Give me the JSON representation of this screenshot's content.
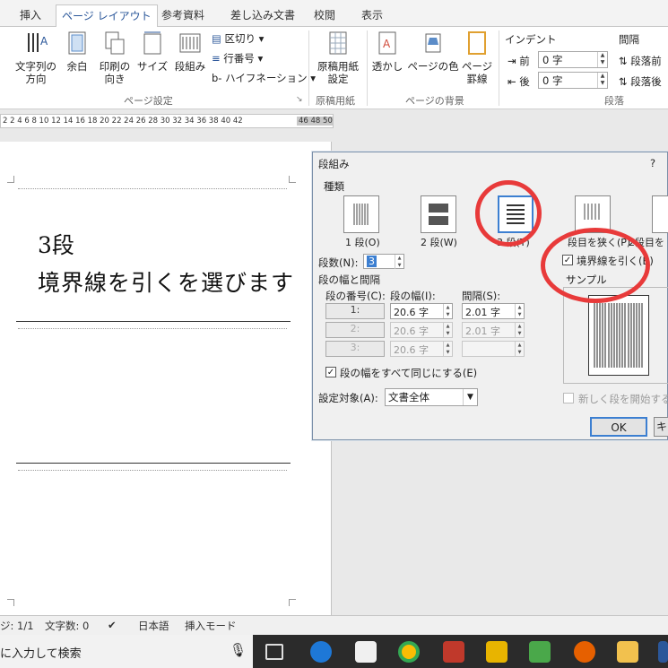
{
  "tabs": [
    "挿入",
    "ページ レイアウト",
    "参考資料",
    "差し込み文書",
    "校閲",
    "表示"
  ],
  "ribbon": {
    "text_direction": "文字列の\n方向",
    "margins": "余白",
    "orientation": "印刷の\n向き",
    "size": "サイズ",
    "columns": "段組み",
    "breaks": "区切り",
    "line_numbers": "行番号",
    "hyphenation": "ハイフネーション",
    "page_setup_group": "ページ設定",
    "manuscript": "原稿用紙\n設定",
    "manuscript_group": "原稿用紙",
    "watermark": "透かし",
    "page_color": "ページの色",
    "page_border": "ページ\n罫線",
    "page_bg_group": "ページの背景",
    "indent_label": "インデント",
    "indent_before_label": "前",
    "indent_before_value": "0 字",
    "indent_after_label": "後",
    "indent_after_value": "0 字",
    "spacing_label": "間隔",
    "spacing_before": "段落前",
    "spacing_after": "段落後",
    "paragraph_group": "段落"
  },
  "ruler": {
    "numbers": "2  2  4  6  8 10 12 14 16 18 20 22 24 26 28 30 32 34 36 38 40 42",
    "tail": "46 48 50"
  },
  "document": {
    "line1": "3段",
    "line2": "境界線を引くを選びます"
  },
  "dialog": {
    "title": "段組み",
    "help": "?",
    "type_label": "種類",
    "presets": [
      "1 段(O)",
      "2 段(W)",
      "3 段(T)",
      "段目を狭く(P)",
      "2段目を"
    ],
    "columns_label": "段数(N):",
    "columns_value": "3",
    "width_spacing_label": "段の幅と間隔",
    "col_number_header": "段の番号(C):",
    "col_width_header": "段の幅(I):",
    "col_spacing_header": "間隔(S):",
    "rows": [
      {
        "num": "1:",
        "width": "20.6 字",
        "spacing": "2.01 字"
      },
      {
        "num": "2:",
        "width": "20.6 字",
        "spacing": "2.01 字"
      },
      {
        "num": "3:",
        "width": "20.6 字",
        "spacing": ""
      }
    ],
    "equal_width_label": "段の幅をすべて同じにする(E)",
    "line_between_label": "境界線を引く(B)",
    "sample_label": "サンプル",
    "apply_to_label": "設定対象(A):",
    "apply_to_value": "文書全体",
    "new_column_label": "新しく段を開始する(U",
    "ok_label": "OK",
    "cancel_label": "キ"
  },
  "status": {
    "page": "ジ: 1/1",
    "words": "文字数: 0",
    "lang": "日本語",
    "mode": "挿入モード"
  },
  "taskbar": {
    "search_placeholder": "に入力して検索"
  },
  "colors": {
    "accent": "#2b579a",
    "highlight_circle": "#e83a3a"
  }
}
